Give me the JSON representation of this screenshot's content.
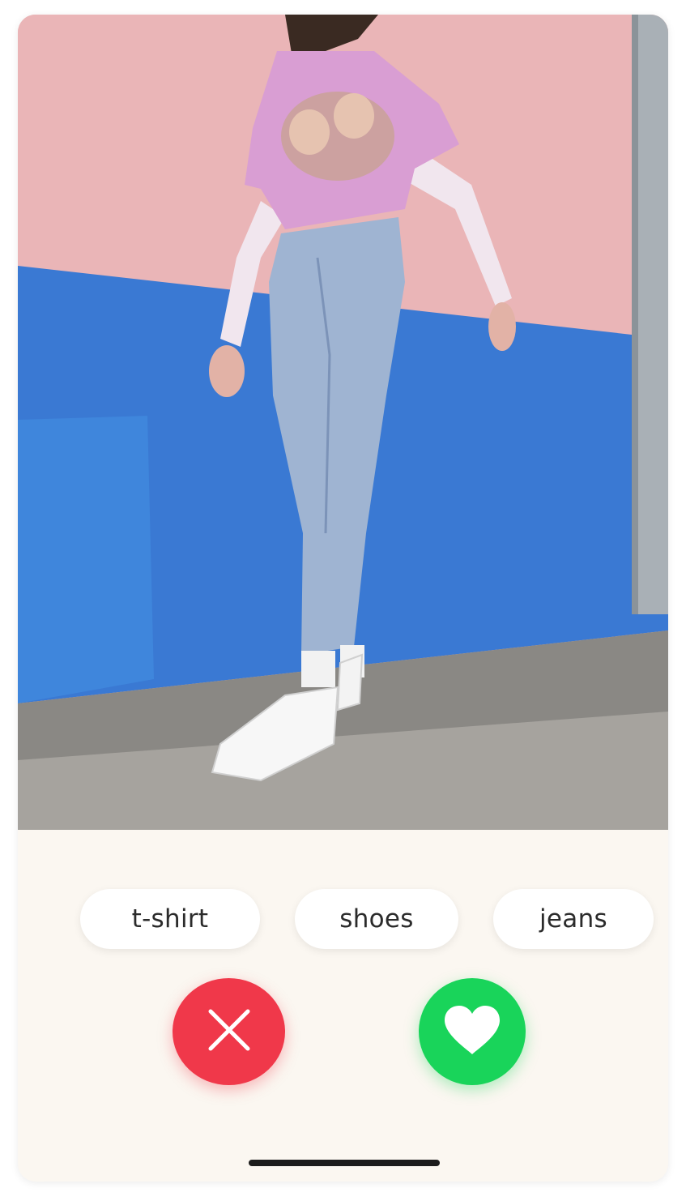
{
  "photo": {
    "alt_subject": "outfit photo"
  },
  "tags": {
    "items": [
      {
        "label": "t-shirt"
      },
      {
        "label": "shoes"
      },
      {
        "label": "jeans"
      }
    ]
  },
  "actions": {
    "reject_icon": "close-icon",
    "like_icon": "heart-icon"
  },
  "colors": {
    "reject": "#f0384a",
    "like": "#19d45a",
    "card_background": "#fbf7f1"
  }
}
